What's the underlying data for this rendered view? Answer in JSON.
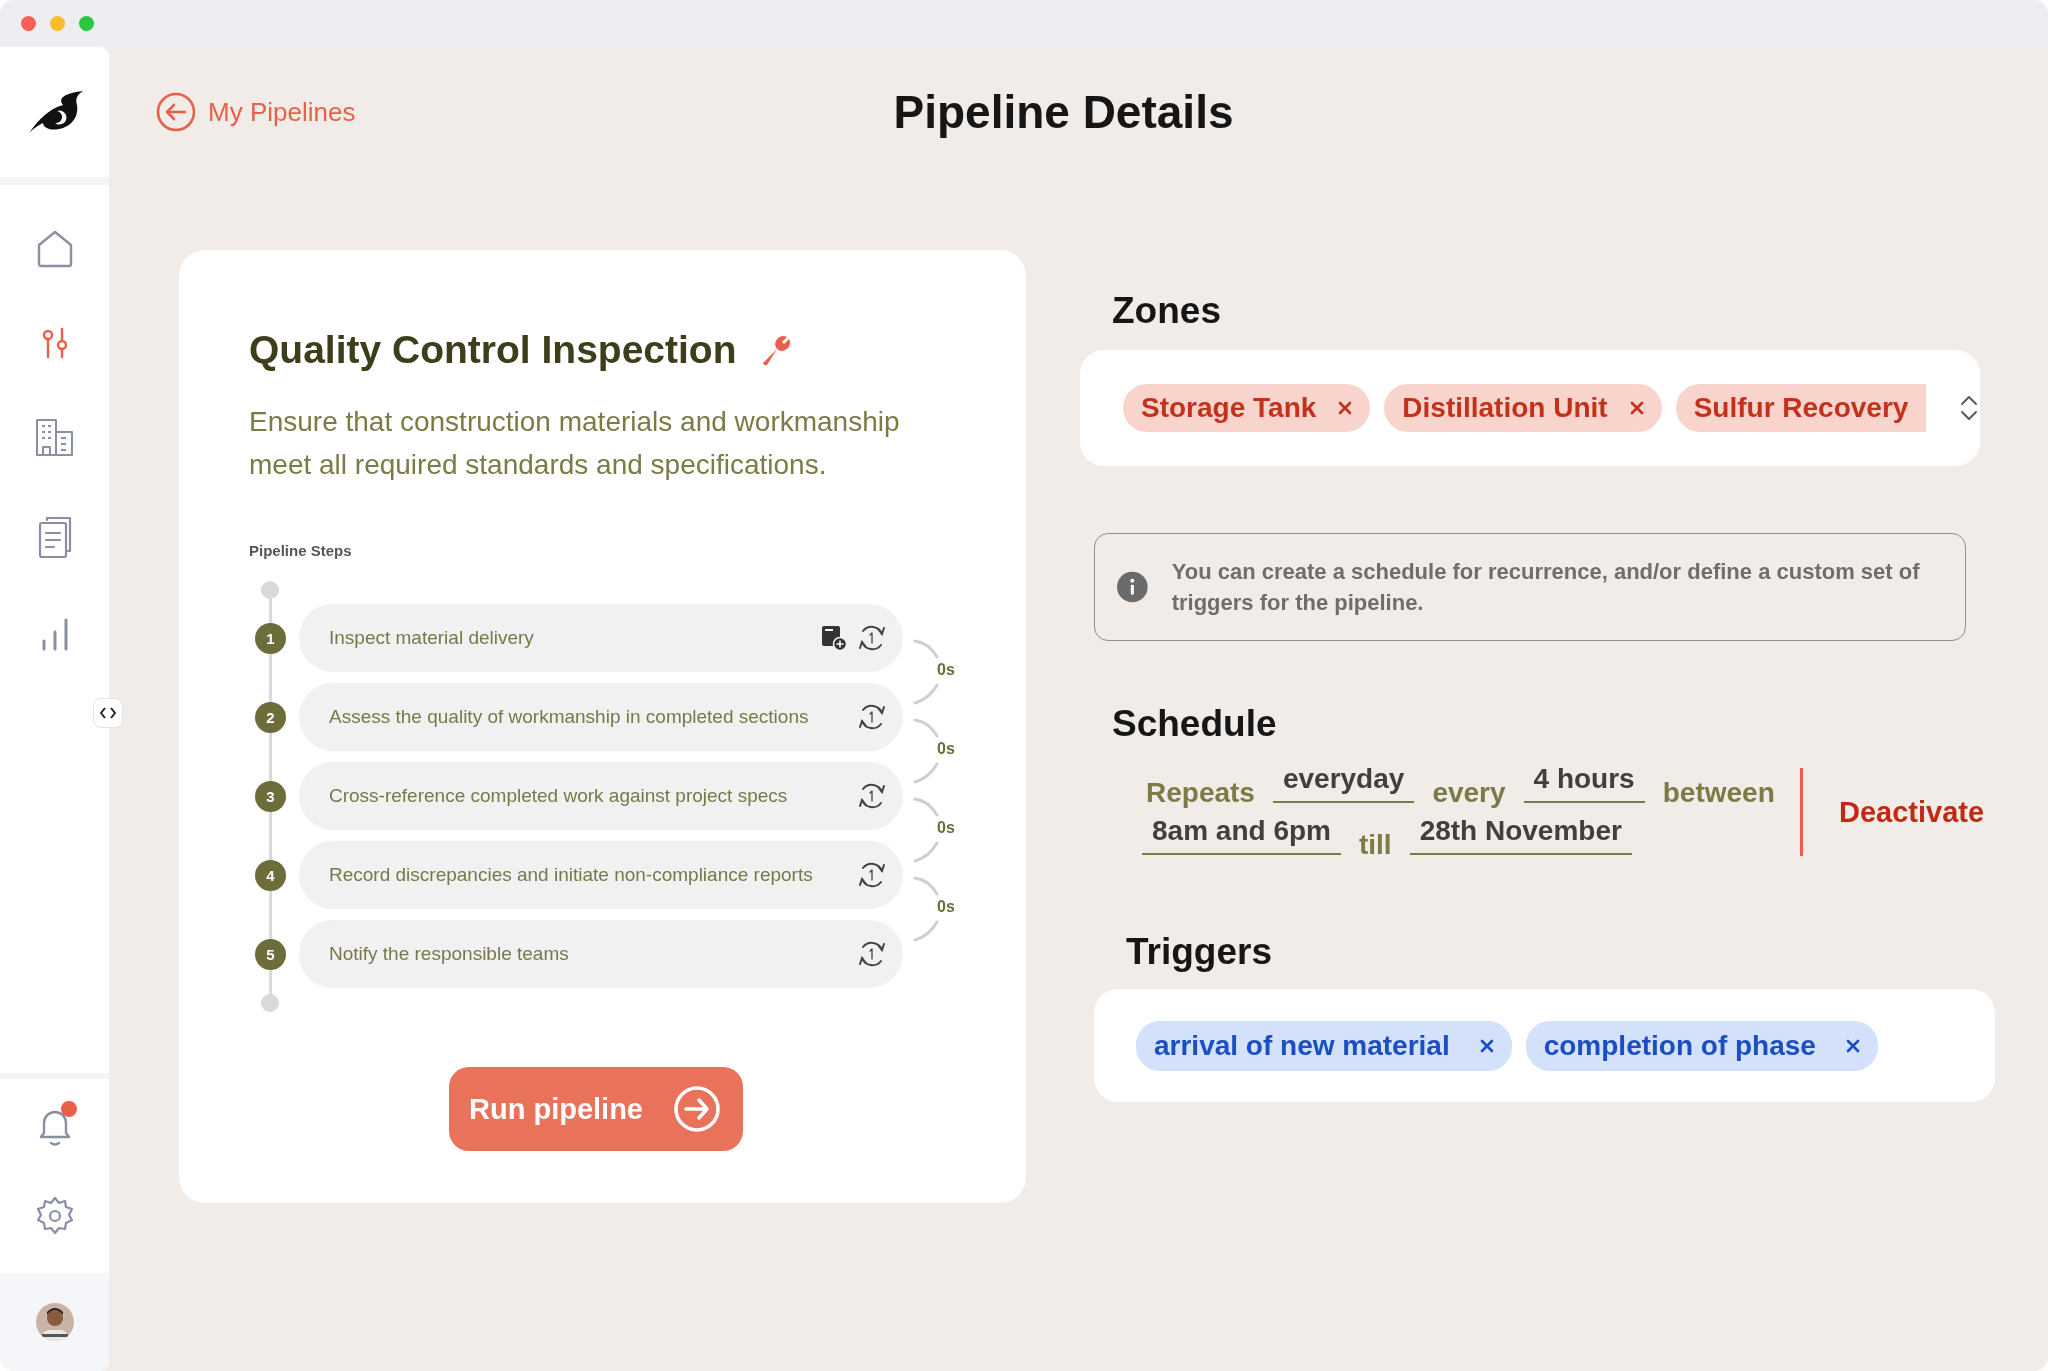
{
  "sidebar": {
    "items": [
      {
        "kind": "home",
        "selected": false
      },
      {
        "kind": "pipelines",
        "selected": true
      },
      {
        "kind": "buildings",
        "selected": false
      },
      {
        "kind": "documents",
        "selected": false
      },
      {
        "kind": "analytics",
        "selected": false
      }
    ],
    "notification": true
  },
  "back_link": {
    "label": "My Pipelines"
  },
  "page_title": "Pipeline Details",
  "pipeline": {
    "title": "Quality Control Inspection",
    "description": "Ensure that construction materials and workmanship meet all required standards and specifications.",
    "steps_label": "Pipeline Steps",
    "steps": [
      {
        "number": "1",
        "text": "Inspect material delivery",
        "attachment": true
      },
      {
        "number": "2",
        "text": "Assess the quality of workmanship in completed sections",
        "attachment": false
      },
      {
        "number": "3",
        "text": "Cross-reference completed work against project specs",
        "attachment": false
      },
      {
        "number": "4",
        "text": "Record discrepancies and initiate non-compliance reports",
        "attachment": false
      },
      {
        "number": "5",
        "text": "Notify the responsible teams",
        "attachment": false
      }
    ],
    "delays": [
      "0s",
      "0s",
      "0s",
      "0s"
    ],
    "run_button": "Run pipeline"
  },
  "zones": {
    "heading": "Zones",
    "chips": [
      {
        "label": "Storage Tank",
        "clipped": false
      },
      {
        "label": "Distillation Unit",
        "clipped": false
      },
      {
        "label": "Sulfur Recovery",
        "clipped": true
      }
    ]
  },
  "info": "You can create a schedule for recurrence, and/or define a custom set of triggers for the pipeline.",
  "schedule": {
    "heading": "Schedule",
    "lines": [
      [
        {
          "kind": "word",
          "text": "Repeats"
        },
        {
          "kind": "value",
          "text": "everyday"
        },
        {
          "kind": "word",
          "text": "every"
        },
        {
          "kind": "value",
          "text": "4 hours"
        },
        {
          "kind": "word",
          "text": "between"
        }
      ],
      [
        {
          "kind": "value",
          "text": "8am and 6pm"
        },
        {
          "kind": "word",
          "text": "till"
        },
        {
          "kind": "value",
          "text": "28th November"
        }
      ]
    ],
    "action": "Deactivate"
  },
  "triggers": {
    "heading": "Triggers",
    "chips": [
      {
        "label": "arrival of new material"
      },
      {
        "label": "completion of phase"
      }
    ]
  }
}
